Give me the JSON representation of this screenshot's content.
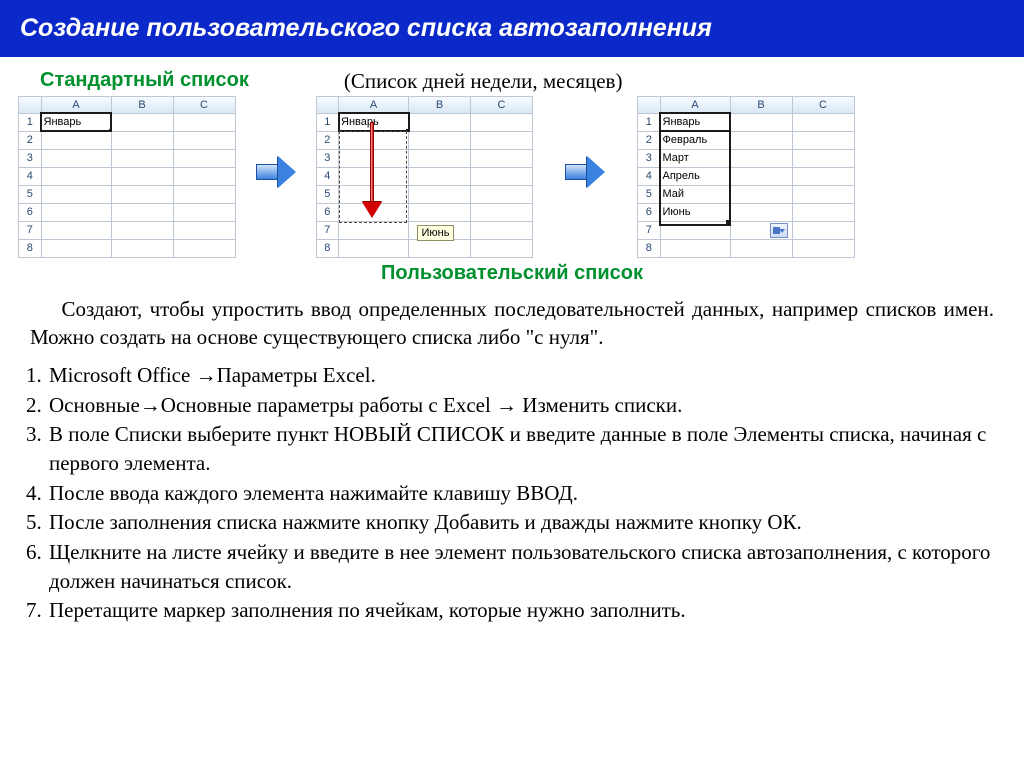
{
  "title": "Создание пользовательского списка автозаполнения",
  "headings": {
    "standard": "Стандартный список",
    "user": "Пользовательский  список",
    "paren": "(Список дней недели, месяцев)"
  },
  "grid_cols": {
    "a": "A",
    "b": "B",
    "c": "C"
  },
  "grid_rows": [
    "1",
    "2",
    "3",
    "4",
    "5",
    "6",
    "7",
    "8"
  ],
  "grid1": {
    "a1": "Январь"
  },
  "grid2": {
    "a1": "Январь",
    "tooltip": "Июнь"
  },
  "grid3": {
    "cells": [
      "Январь",
      "Февраль",
      "Март",
      "Апрель",
      "Май",
      "Июнь"
    ]
  },
  "para": "Создают, чтобы упростить ввод определенных последовательностей данных, например списков имен.  Можно создать на основе существующего списка либо \"с нуля\".",
  "steps": [
    "Microsoft Office →Параметры Excel.",
    "Основные→Основные параметры работы с Excel → Изменить списки.",
    "В поле Списки выберите пункт НОВЫЙ СПИСОК и введите данные в поле Элементы списка, начиная с первого элемента.",
    "После ввода каждого элемента нажимайте клавишу ВВОД.",
    "После заполнения списка нажмите кнопку Добавить и дважды нажмите кнопку ОК.",
    "Щелкните на листе ячейку и введите в нее элемент пользовательского списка автозаполнения, с которого должен начинаться список.",
    "Перетащите маркер заполнения по ячейкам, которые нужно заполнить."
  ]
}
